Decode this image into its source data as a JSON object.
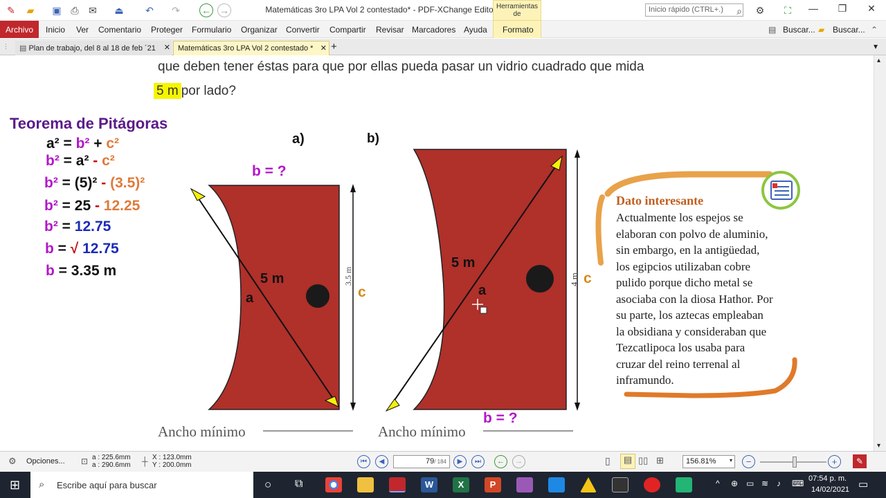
{
  "window": {
    "title": "Matemáticas 3ro LPA Vol 2 contestado* - PDF-XChange Editor",
    "context_tab": "Herramientas de",
    "quick_search_placeholder": "Inicio rápido (CTRL+.)"
  },
  "menu": {
    "archivo": "Archivo",
    "items": [
      "Inicio",
      "Ver",
      "Comentario",
      "Proteger",
      "Formulario",
      "Organizar",
      "Convertir",
      "Compartir",
      "Revisar",
      "Marcadores",
      "Ayuda"
    ],
    "formato": "Formato",
    "buscar1": "Buscar...",
    "buscar2": "Buscar..."
  },
  "tabs": [
    {
      "label": "Plan de trabajo, del 8 al 18 de feb ´21"
    },
    {
      "label": "Matemáticas 3ro LPA Vol 2 contestado *"
    }
  ],
  "doc": {
    "line1": "que deben tener éstas para que por ellas pueda pasar un vidrio cuadrado que mida",
    "highlight": "5 m",
    "line2_rest": "por lado?",
    "theorem_title": "Teorema de Pitágoras",
    "label_a": "a)",
    "label_b": "b)",
    "b_eq_top": "b = ?",
    "b_eq_bottom": "b = ?",
    "fig_a_diag": "5 m",
    "fig_a_letter": "a",
    "fig_a_side": "3.5 m",
    "fig_a_c": "c",
    "fig_b_diag": "5 m",
    "fig_b_letter": "a",
    "fig_b_side": "4 m",
    "fig_b_c": "c",
    "ancho1": "Ancho mínimo",
    "ancho2": "Ancho mínimo",
    "dato_title": "Dato interesante",
    "dato_lines": [
      "Actualmente los espejos se",
      "elaboran con polvo de aluminio,",
      "sin embargo, en la antigüedad,",
      "los egipcios utilizaban cobre",
      "pulido porque dicho metal se",
      "asociaba con la diosa Hathor. Por",
      "su parte, los aztecas empleaban",
      "la obsidiana y consideraban que",
      "Tezcatlipoca los usaba para",
      "cruzar del reino terrenal al",
      "inframundo."
    ]
  },
  "formulas": {
    "f1": {
      "a": "a² = ",
      "b": "b²",
      "plus": " + ",
      "c": "c²"
    },
    "f2": {
      "b": "b²",
      "eq": " = a² ",
      "minus": "- ",
      "c": "c²"
    },
    "f3": {
      "b": "b²",
      "eq": " = (5)² ",
      "minus": "- ",
      "v": "(3.5)²"
    },
    "f4": {
      "b": "b²",
      "eq": " = 25 ",
      "minus": "- ",
      "v": "12.25"
    },
    "f5": {
      "b": "b²",
      "eq": " = ",
      "v": " 12.75"
    },
    "f6": {
      "b": "b",
      "eq": " = ",
      "root": "√",
      "v": " 12.75"
    },
    "f7": {
      "b": "b",
      "v": "  = 3.35 m"
    }
  },
  "status": {
    "opciones": "Opciones...",
    "dim_a": "a : 225.6mm",
    "dim_a2": "a : 290.6mm",
    "x": "X : 123.0mm",
    "y": "Y : 200.0mm",
    "page": "79",
    "page_total": "/ 184",
    "zoom": "156.81%"
  },
  "taskbar": {
    "search": "Escribe aquí para buscar",
    "time": "07:54 p. m.",
    "date": "14/02/2021"
  },
  "colors": {
    "accent": "#c0282d",
    "figure": "#b0302a",
    "purple": "#b117c8",
    "orange": "#e07a3a",
    "blue": "#1a2bb8"
  }
}
